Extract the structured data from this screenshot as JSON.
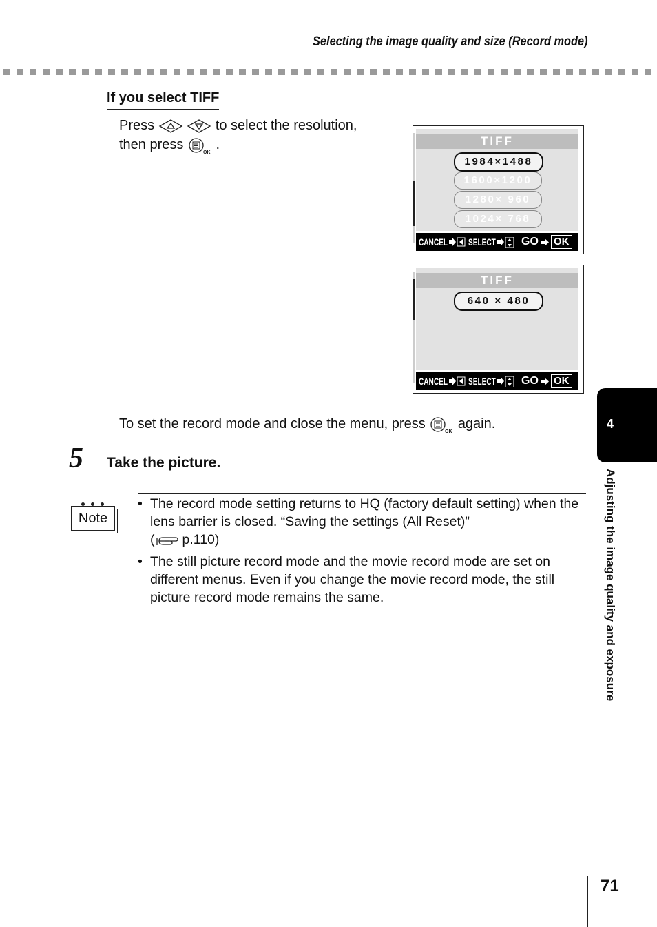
{
  "header": {
    "title": "Selecting the image quality and size (Record mode)"
  },
  "section": {
    "heading": "If you select TIFF",
    "instruction": {
      "press_word": "Press",
      "after_arrows": "to select the resolution,",
      "then_press": "then press",
      "end": "."
    }
  },
  "screens": [
    {
      "title": "TIFF",
      "options": [
        "1984×1488",
        "1600×1200",
        "1280× 960",
        "1024× 768"
      ],
      "selected_index": 0,
      "bottom": {
        "cancel": "CANCEL",
        "select": "SELECT",
        "go": "GO",
        "ok": "OK"
      }
    },
    {
      "title": "TIFF",
      "options": [
        "640 × 480"
      ],
      "selected_index": 0,
      "bottom": {
        "cancel": "CANCEL",
        "select": "SELECT",
        "go": "GO",
        "ok": "OK"
      }
    }
  ],
  "close_instruction": {
    "before": "To set the record mode and close the menu, press",
    "after": "again."
  },
  "step": {
    "number": "5",
    "text": "Take the picture."
  },
  "note": {
    "label": "Note",
    "bullets": [
      {
        "text": "The record mode setting returns to HQ (factory default setting) when the lens barrier is closed. “Saving the settings (All Reset)”",
        "ref_open": "(",
        "ref_page": "p.110)"
      },
      {
        "text": "The still picture record mode and the movie record mode are set on different menus. Even if you change the movie record mode, the still picture record mode remains the same."
      }
    ]
  },
  "side_tab": {
    "chapter": "4",
    "label": "Adjusting the image quality and exposure"
  },
  "page_number": "71"
}
